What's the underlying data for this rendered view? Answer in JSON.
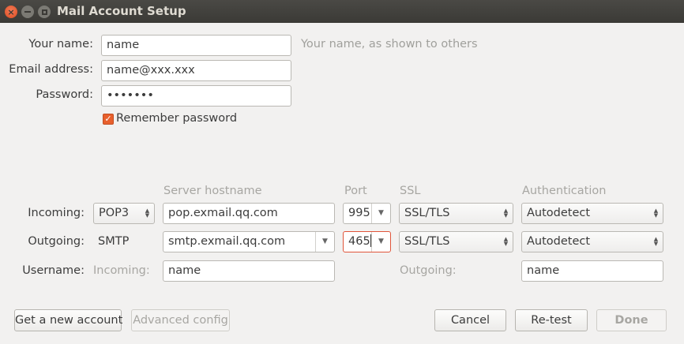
{
  "window": {
    "title": "Mail Account Setup"
  },
  "identity": {
    "name_label": "Your name:",
    "name_value": "name",
    "name_hint": "Your name, as shown to others",
    "email_label": "Email address:",
    "email_value": "name@xxx.xxx",
    "password_label": "Password:",
    "password_value": "•••••••",
    "remember_label": "Remember password",
    "remember_checked": true
  },
  "servers": {
    "headers": {
      "hostname": "Server hostname",
      "port": "Port",
      "ssl": "SSL",
      "auth": "Authentication"
    },
    "incoming": {
      "label": "Incoming:",
      "protocol": "POP3",
      "hostname": "pop.exmail.qq.com",
      "port": "995",
      "ssl": "SSL/TLS",
      "auth": "Autodetect"
    },
    "outgoing": {
      "label": "Outgoing:",
      "protocol": "SMTP",
      "hostname": "smtp.exmail.qq.com",
      "port": "465",
      "ssl": "SSL/TLS",
      "auth": "Autodetect"
    },
    "username": {
      "label": "Username:",
      "incoming_label": "Incoming:",
      "incoming_value": "name",
      "outgoing_label": "Outgoing:",
      "outgoing_value": "name"
    }
  },
  "buttons": {
    "get_new": "Get a new account",
    "advanced": "Advanced config",
    "cancel": "Cancel",
    "retest": "Re-test",
    "done": "Done"
  },
  "colors": {
    "accent": "#e8602d",
    "titlebar": "#3b3a36",
    "focus_border": "#e0553a"
  }
}
